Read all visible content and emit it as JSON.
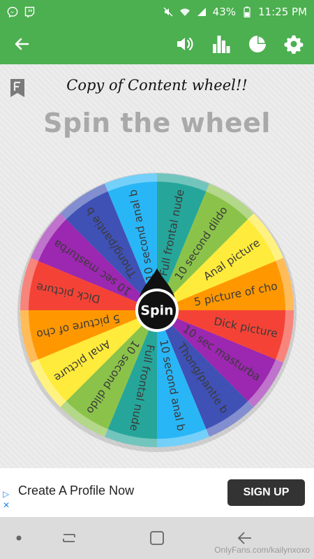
{
  "status_bar": {
    "battery": "43%",
    "time": "11:25 PM",
    "icons": [
      "messenger-icon",
      "twitch-icon",
      "mute-icon",
      "wifi-icon",
      "signal-icon",
      "battery-icon"
    ]
  },
  "app_bar": {
    "back_icon": "arrow-left-icon",
    "action_icons": [
      "volume-icon",
      "bar-chart-icon",
      "pie-chart-icon",
      "settings-gear-icon"
    ],
    "color": "#4caf50"
  },
  "main": {
    "wheel_title": "Copy of Content wheel!!",
    "heading": "Spin the wheel",
    "spin_button": "Spin",
    "segments": [
      {
        "label": "Full frontal nude",
        "color": "#26a69a"
      },
      {
        "label": "10 second dildo",
        "color": "#8bc34a"
      },
      {
        "label": "Anal picture",
        "color": "#ffeb3b"
      },
      {
        "label": "5 picture of cho",
        "color": "#ff9800"
      },
      {
        "label": "Dick picture",
        "color": "#f44336"
      },
      {
        "label": "10 sec masturba",
        "color": "#9c27b0"
      },
      {
        "label": "Thong/pantie b",
        "color": "#3f51b5"
      },
      {
        "label": "10 second anal b",
        "color": "#29b6f6"
      },
      {
        "label": "Full frontal nude",
        "color": "#26a69a"
      },
      {
        "label": "10 second dildo",
        "color": "#8bc34a"
      },
      {
        "label": "Anal picture",
        "color": "#ffeb3b"
      },
      {
        "label": "5 picture of cho",
        "color": "#ff9800"
      },
      {
        "label": "Dick picture",
        "color": "#f44336"
      },
      {
        "label": "10 sec masturba",
        "color": "#9c27b0"
      },
      {
        "label": "Thong/pantie b",
        "color": "#3f51b5"
      },
      {
        "label": "10 second anal b",
        "color": "#29b6f6"
      }
    ]
  },
  "ad": {
    "text": "Create A Profile Now",
    "button": "SIGN UP"
  },
  "nav_bar": {
    "icons": [
      "dot-icon",
      "recent-apps-icon",
      "home-icon",
      "back-icon"
    ]
  },
  "watermark": "OnlyFans.com/kailynxoxo"
}
